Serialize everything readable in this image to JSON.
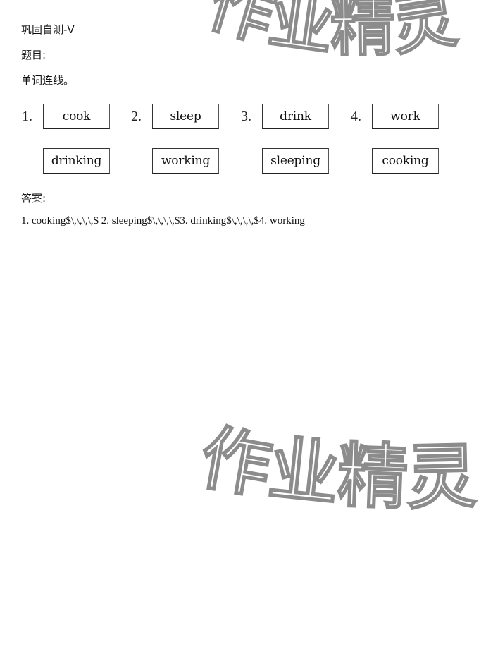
{
  "header": {
    "title": "巩固自测-V",
    "question_label": "题目:",
    "instruction": "单词连线。"
  },
  "exercise": {
    "numbers": [
      "1.",
      "2.",
      "3.",
      "4."
    ],
    "top_words": [
      "cook",
      "sleep",
      "drink",
      "work"
    ],
    "bottom_words": [
      "drinking",
      "working",
      "sleeping",
      "cooking"
    ]
  },
  "answer": {
    "label": "答案:",
    "text": "1. cooking$\\,\\,\\,\\,$ 2. sleeping$\\,\\,\\,\\,$3. drinking$\\,\\,\\,\\,$4. working"
  },
  "watermark": {
    "text": "作业精灵"
  }
}
